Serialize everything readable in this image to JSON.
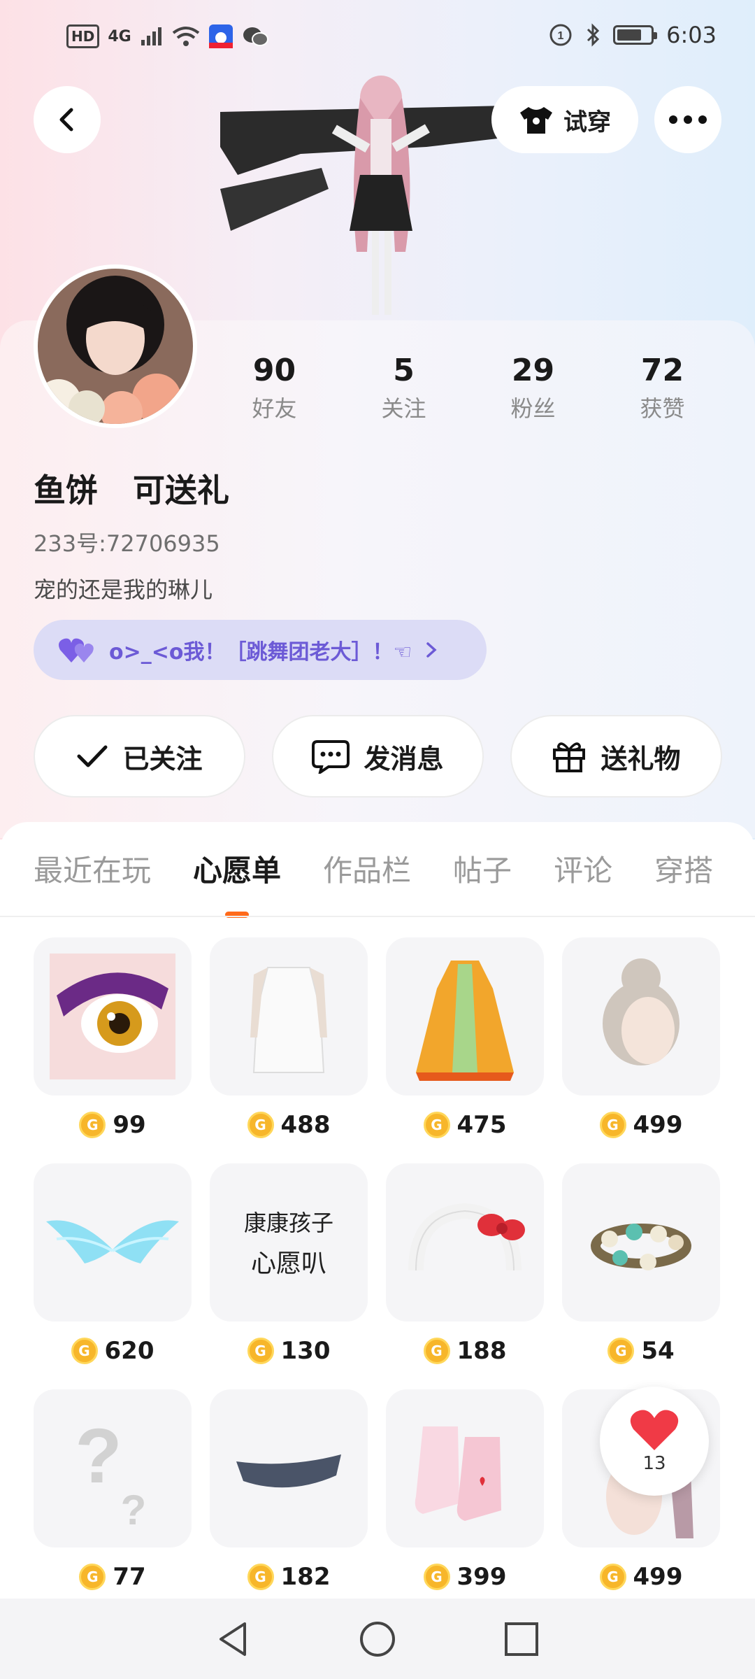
{
  "status_bar": {
    "hd": "HD",
    "network": "4G",
    "time": "6:03",
    "battery_level": 0.65
  },
  "header": {
    "tryon_label": "试穿"
  },
  "profile": {
    "stats": [
      {
        "value": "90",
        "label": "好友"
      },
      {
        "value": "5",
        "label": "关注"
      },
      {
        "value": "29",
        "label": "粉丝"
      },
      {
        "value": "72",
        "label": "获赞"
      }
    ],
    "nickname": "鱼饼",
    "nickname_suffix": "可送礼",
    "uid": "233号:72706935",
    "bio": "宠的还是我的琳儿",
    "tag_text": "o>_<o我！［跳舞团老大］！☜",
    "tag_color": "#6c5ad6"
  },
  "actions": {
    "following_label": "已关注",
    "message_label": "发消息",
    "gift_label": "送礼物"
  },
  "tabs": [
    "最近在玩",
    "心愿单",
    "作品栏",
    "帖子",
    "评论",
    "穿搭"
  ],
  "active_tab": 1,
  "wishlist": {
    "items": [
      {
        "name": "eye-makeup",
        "price": "99"
      },
      {
        "name": "white-dress",
        "price": "488"
      },
      {
        "name": "chinese-robe",
        "price": "475"
      },
      {
        "name": "bun-hairstyle",
        "price": "499"
      },
      {
        "name": "ice-wings",
        "price": "620"
      },
      {
        "name": "text-card",
        "price": "130",
        "text_top": "康康孩子",
        "text_bottom": "心愿叭"
      },
      {
        "name": "cat-ear-headband",
        "price": "188"
      },
      {
        "name": "flower-wreath",
        "price": "54"
      },
      {
        "name": "mystery-item",
        "price": "77"
      },
      {
        "name": "lace-choker",
        "price": "182"
      },
      {
        "name": "pink-boots",
        "price": "399"
      },
      {
        "name": "long-hair",
        "price": "499"
      }
    ]
  },
  "like_fab": {
    "count": "13"
  },
  "colors": {
    "accent": "#ff6a1a",
    "coin": "#f7b62a",
    "heart": "#f03a46"
  }
}
